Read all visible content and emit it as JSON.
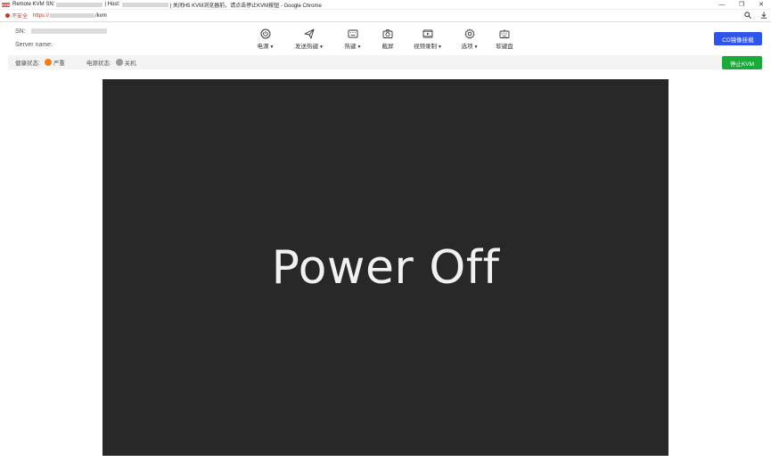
{
  "window": {
    "title_prefix": "Remote KVM SN:",
    "title_host": "| Host:",
    "title_suffix": "| 关闭H5 KVM浏览器前，请点击停止KVM按钮 - Google Chrome",
    "logo_text": "KVM",
    "controls": [
      "—",
      "❐",
      "✕"
    ]
  },
  "urlbar": {
    "insecure_label": "不安全",
    "scheme": "https://",
    "path": "/kvm"
  },
  "header": {
    "sn_label": "SN:",
    "server_label": "Server name:"
  },
  "toolbar": {
    "items": [
      {
        "label": "电源",
        "icon": "power-icon",
        "has_caret": true
      },
      {
        "label": "发送热键",
        "icon": "send-icon",
        "has_caret": true
      },
      {
        "label": "热键",
        "icon": "keyboard-icon",
        "has_caret": true
      },
      {
        "label": "截屏",
        "icon": "camera-icon",
        "has_caret": false
      },
      {
        "label": "视频录制",
        "icon": "video-record-icon",
        "has_caret": true
      },
      {
        "label": "选项",
        "icon": "gear-icon",
        "has_caret": true
      },
      {
        "label": "软键盘",
        "icon": "soft-keyboard-icon",
        "has_caret": false
      }
    ],
    "caret": "▼"
  },
  "buttons": {
    "cd_mount": "CD镜像挂载",
    "stop_kvm": "停止KVM"
  },
  "status": {
    "health_label": "健康状态:",
    "health_value": "严重",
    "health_color": "#f07f1a",
    "power_label": "电源状态:",
    "power_value": "关机",
    "power_color": "#9e9e9e"
  },
  "screen": {
    "message": "Power Off",
    "background": "#282828"
  }
}
